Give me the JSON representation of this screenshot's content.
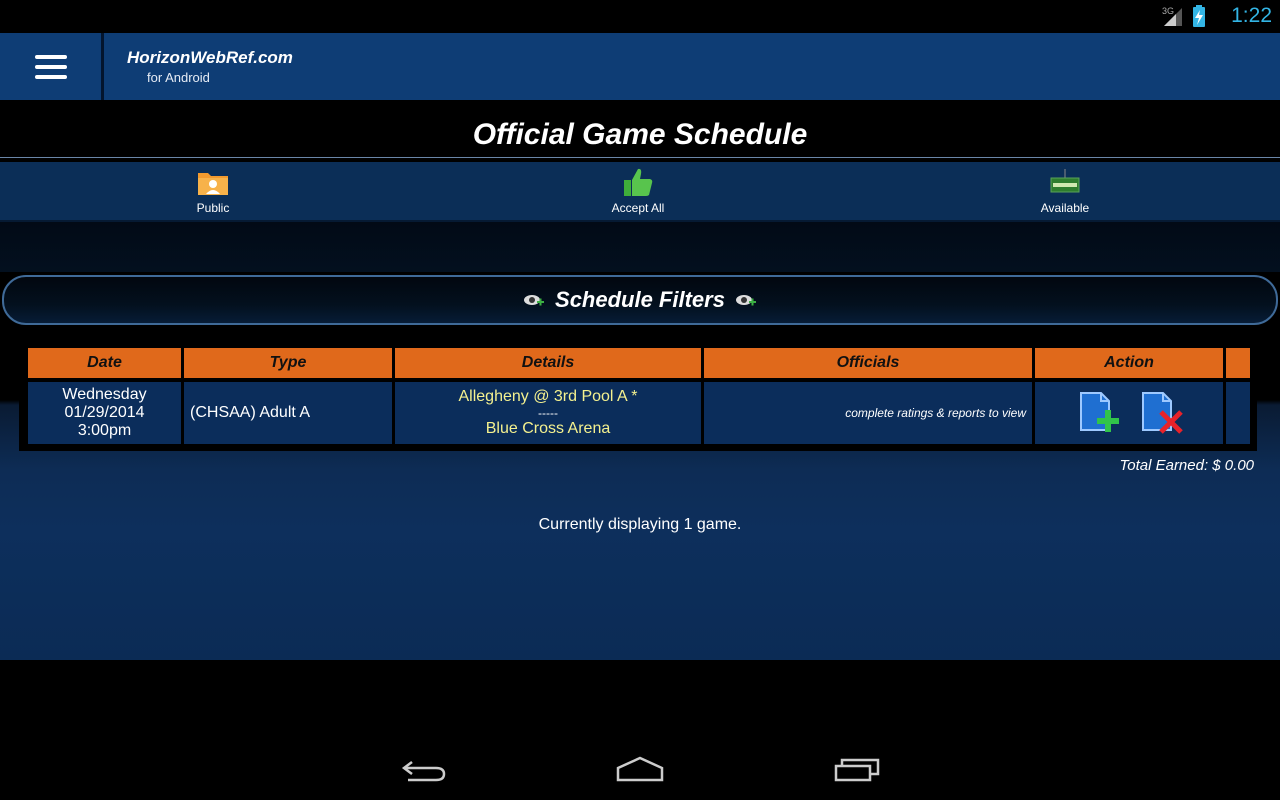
{
  "status_bar": {
    "network": "3G",
    "time": "1:22"
  },
  "app": {
    "title": "HorizonWebRef.com",
    "subtitle": "for Android"
  },
  "page": {
    "title": "Official Game Schedule"
  },
  "toolbar": [
    {
      "label": "Public",
      "icon": "public-folder-icon"
    },
    {
      "label": "Accept All",
      "icon": "thumbs-up-icon"
    },
    {
      "label": "Available",
      "icon": "available-sign-icon"
    }
  ],
  "filters": {
    "label": "Schedule Filters"
  },
  "table": {
    "headers": [
      "Date",
      "Type",
      "Details",
      "Officials",
      "Action",
      ""
    ],
    "rows": [
      {
        "date_day": "Wednesday",
        "date": "01/29/2014",
        "time": "3:00pm",
        "type": "(CHSAA) Adult A",
        "matchup": "Allegheny @ 3rd Pool A *",
        "separator": "-----",
        "venue": "Blue Cross Arena",
        "officials": "complete ratings & reports to view",
        "actions": [
          "accept-game-icon",
          "decline-game-icon"
        ]
      }
    ]
  },
  "summary": {
    "total_earned": "Total Earned: $ 0.00",
    "count_text": "Currently displaying 1 game."
  },
  "colors": {
    "header_blue": "#0e3d75",
    "accent_orange": "#e0691b",
    "details_yellow": "#f4f18f",
    "clock_blue": "#33b5e5"
  }
}
